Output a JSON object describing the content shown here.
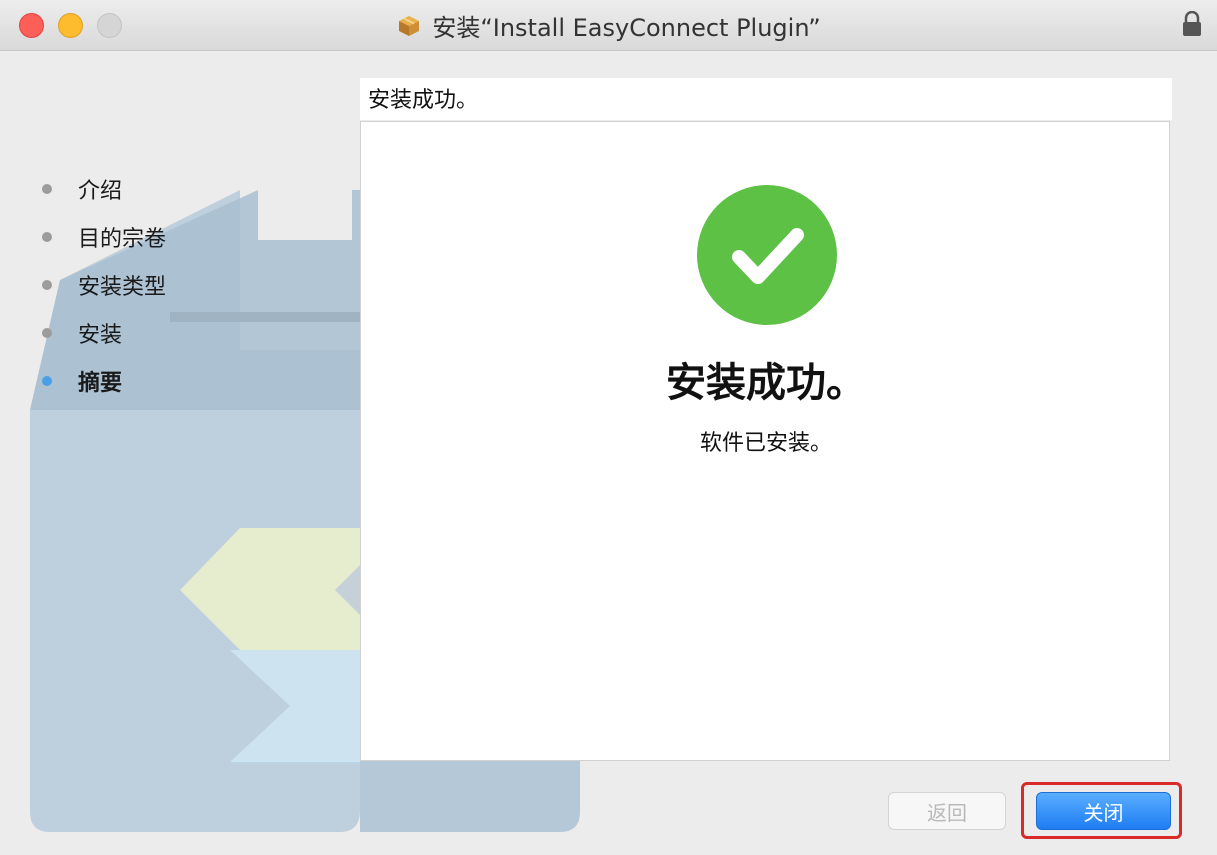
{
  "window": {
    "title": "安装“Install EasyConnect Plugin”",
    "icon": "package-icon",
    "lock_icon": "lock-icon"
  },
  "sidebar": {
    "steps": [
      {
        "label": "介绍",
        "state": "done"
      },
      {
        "label": "目的宗卷",
        "state": "done"
      },
      {
        "label": "安装类型",
        "state": "done"
      },
      {
        "label": "安装",
        "state": "done"
      },
      {
        "label": "摘要",
        "state": "current"
      }
    ]
  },
  "content": {
    "header": "安装成功。",
    "status_icon": "checkmark-circle-icon",
    "title": "安装成功。",
    "message": "软件已安装。"
  },
  "buttons": {
    "back": "返回",
    "close": "关闭"
  },
  "colors": {
    "success_green": "#5cc144",
    "accent_blue": "#1e7df2",
    "highlight_red": "#d92a2a",
    "active_step_dot": "#4a9fe8"
  }
}
